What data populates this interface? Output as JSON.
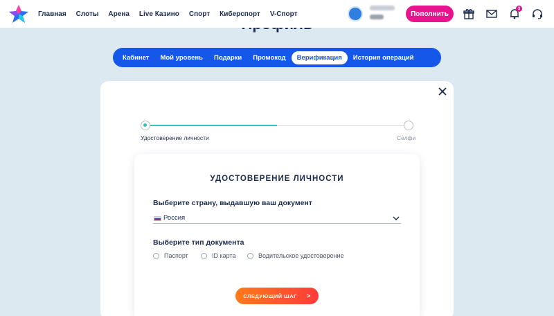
{
  "header": {
    "nav": [
      "Главная",
      "Слоты",
      "Арена",
      "Live Казино",
      "Спорт",
      "Киберспорт",
      "V-Спорт"
    ],
    "topup_label": "Пополнить",
    "notifications_count": "3"
  },
  "page": {
    "title": "Профиль"
  },
  "tabs": [
    {
      "label": "Кабинет",
      "active": false
    },
    {
      "label": "Мой уровень",
      "active": false
    },
    {
      "label": "Подарки",
      "active": false
    },
    {
      "label": "Промокод",
      "active": false
    },
    {
      "label": "Верификация",
      "active": true
    },
    {
      "label": "История операций",
      "active": false
    }
  ],
  "stepper": {
    "step1_label": "Удостоверение личности",
    "step2_label": "Селфи",
    "progress": 0.5
  },
  "form": {
    "title": "УДОСТОВЕРЕНИЕ ЛИЧНОСТИ",
    "country_label": "Выберите страну, выдавшую ваш документ",
    "country_value": "Россия",
    "doc_type_label": "Выберите тип документа",
    "doc_types": [
      "Паспорт",
      "ID карта",
      "Водительское удостоверение"
    ],
    "next_label": "СЛЕДУЮЩИЙ ШАГ",
    "next_arrow": ">"
  },
  "colors": {
    "accent_blue": "#1557e8",
    "accent_pink": "#e6158e",
    "progress_teal": "#2ec7b7",
    "button_gradient_start": "#ff7a1a",
    "button_gradient_end": "#ff3b3b"
  }
}
